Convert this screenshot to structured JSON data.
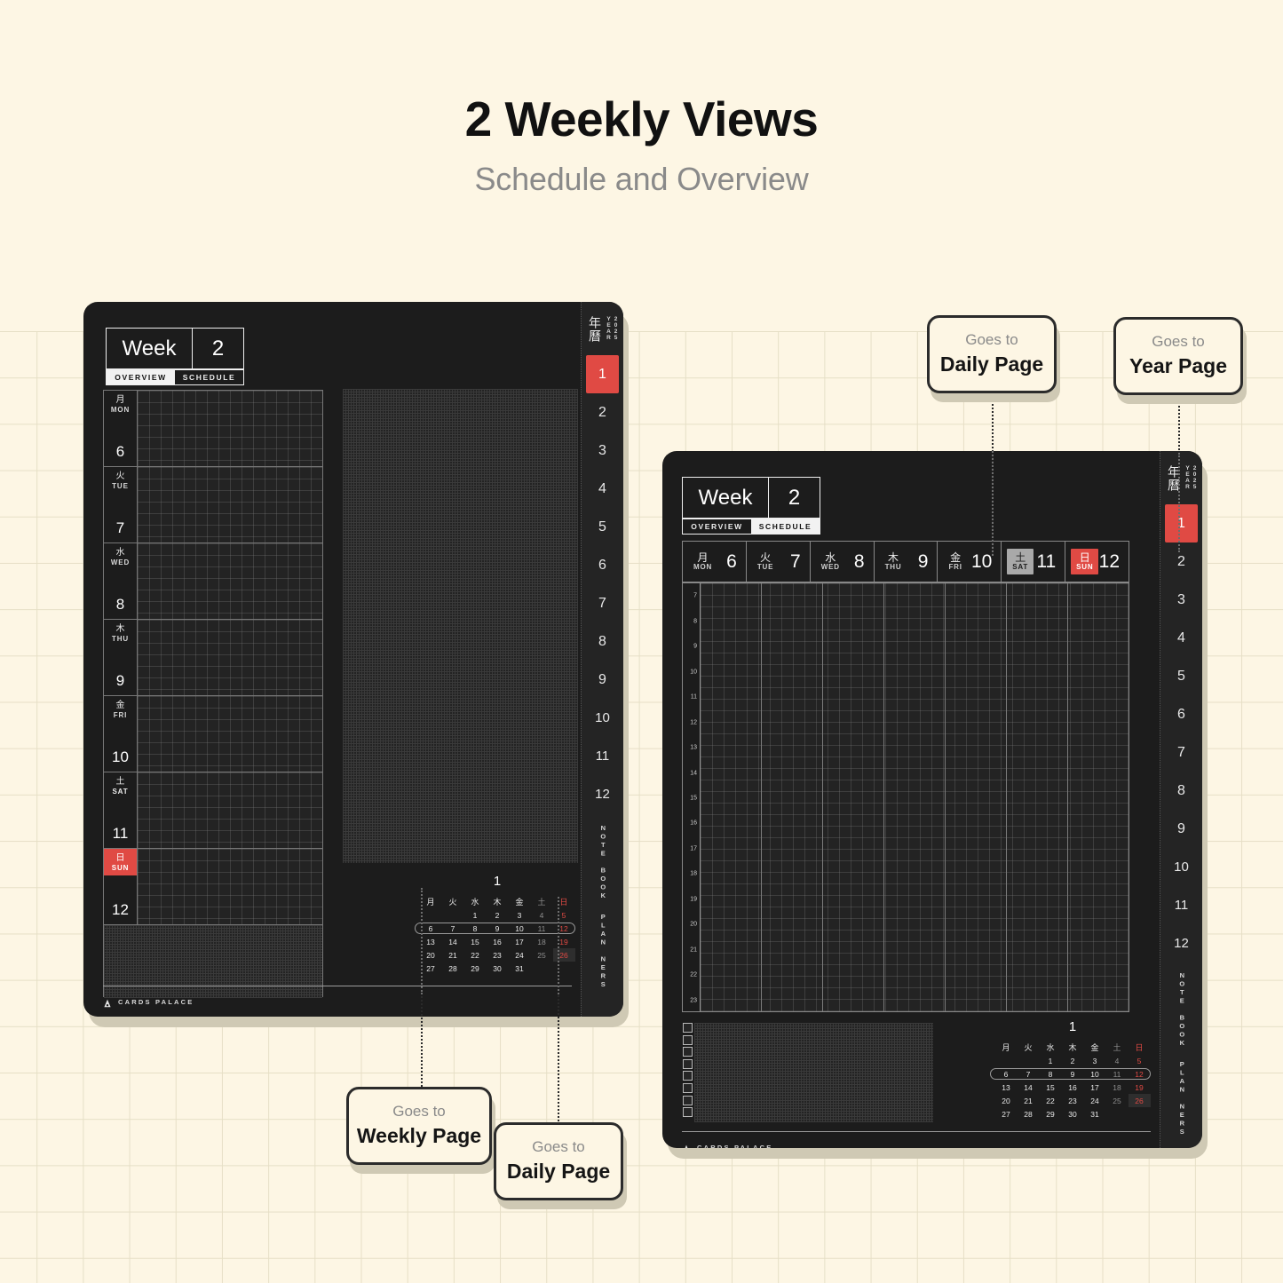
{
  "headline": {
    "title": "2 Weekly Views",
    "subtitle": "Schedule and Overview"
  },
  "colors": {
    "page_bg": "#FDF6E4",
    "grid_line": "#E6DFC6",
    "device_bg": "#1C1C1C",
    "accent_red": "#E04A44",
    "saturday_gray": "#A9A9A9",
    "ink": "#151515",
    "muted": "#8A8A8A"
  },
  "rail": {
    "kanji": "年曆",
    "year_label": "YEAR",
    "year": "2025",
    "months": [
      "1",
      "2",
      "3",
      "4",
      "5",
      "6",
      "7",
      "8",
      "9",
      "10",
      "11",
      "12"
    ],
    "active_month": "1",
    "footer": [
      "NOTE BOOK",
      "PLAN NERS"
    ]
  },
  "brand": {
    "name": "CARDS PALACE",
    "logo_icon": "bell-logo-icon"
  },
  "mini_calendar": {
    "month": "1",
    "weekday_headers": [
      "月",
      "火",
      "水",
      "木",
      "金",
      "土",
      "日"
    ],
    "weeks": [
      [
        "",
        "",
        "1",
        "2",
        "3",
        "4",
        "5"
      ],
      [
        "6",
        "7",
        "8",
        "9",
        "10",
        "11",
        "12"
      ],
      [
        "13",
        "14",
        "15",
        "16",
        "17",
        "18",
        "19"
      ],
      [
        "20",
        "21",
        "22",
        "23",
        "24",
        "25",
        "26"
      ],
      [
        "27",
        "28",
        "29",
        "30",
        "31",
        "",
        ""
      ]
    ],
    "highlighted_week_index": 1,
    "highlighted_day": "26"
  },
  "overview_page": {
    "week_word": "Week",
    "week_number": "2",
    "tabs": [
      {
        "label": "OVERVIEW",
        "active": true
      },
      {
        "label": "SCHEDULE",
        "active": false
      }
    ],
    "days": [
      {
        "jp": "月",
        "en": "MON",
        "num": "6",
        "style": "normal"
      },
      {
        "jp": "火",
        "en": "TUE",
        "num": "7",
        "style": "normal"
      },
      {
        "jp": "水",
        "en": "WED",
        "num": "8",
        "style": "normal"
      },
      {
        "jp": "木",
        "en": "THU",
        "num": "9",
        "style": "normal"
      },
      {
        "jp": "金",
        "en": "FRI",
        "num": "10",
        "style": "normal"
      },
      {
        "jp": "土",
        "en": "SAT",
        "num": "11",
        "style": "sat"
      },
      {
        "jp": "日",
        "en": "SUN",
        "num": "12",
        "style": "sun"
      }
    ]
  },
  "schedule_page": {
    "week_word": "Week",
    "week_number": "2",
    "tabs": [
      {
        "label": "OVERVIEW",
        "active": false
      },
      {
        "label": "SCHEDULE",
        "active": true
      }
    ],
    "days": [
      {
        "jp": "月",
        "en": "MON",
        "num": "6",
        "style": "normal"
      },
      {
        "jp": "火",
        "en": "TUE",
        "num": "7",
        "style": "normal"
      },
      {
        "jp": "水",
        "en": "WED",
        "num": "8",
        "style": "normal"
      },
      {
        "jp": "木",
        "en": "THU",
        "num": "9",
        "style": "normal"
      },
      {
        "jp": "金",
        "en": "FRI",
        "num": "10",
        "style": "normal"
      },
      {
        "jp": "土",
        "en": "SAT",
        "num": "11",
        "style": "sat"
      },
      {
        "jp": "日",
        "en": "SUN",
        "num": "12",
        "style": "sun"
      }
    ],
    "hours": [
      "7",
      "8",
      "9",
      "10",
      "11",
      "12",
      "13",
      "14",
      "15",
      "16",
      "17",
      "18",
      "19",
      "20",
      "21",
      "22",
      "23"
    ],
    "todo_checkbox_count": 8
  },
  "callouts": [
    {
      "id": "daily-top",
      "top": "Goes to",
      "main": "Daily Page"
    },
    {
      "id": "year-top",
      "top": "Goes to",
      "main": "Year Page"
    },
    {
      "id": "weekly-bottom",
      "top": "Goes to",
      "main": "Weekly Page"
    },
    {
      "id": "daily-bottom",
      "top": "Goes to",
      "main": "Daily Page"
    }
  ]
}
